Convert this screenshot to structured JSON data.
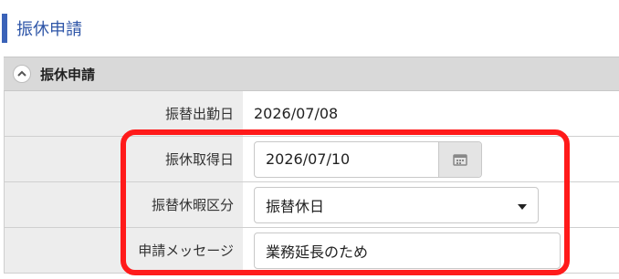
{
  "page": {
    "title": "振休申請"
  },
  "section": {
    "title": "振休申請"
  },
  "form": {
    "work_date": {
      "label": "振替出勤日",
      "value": "2026/07/08"
    },
    "leave_date": {
      "label": "振休取得日",
      "value": "2026/07/10"
    },
    "leave_type": {
      "label": "振替休暇区分",
      "value": "振替休日"
    },
    "message": {
      "label": "申請メッセージ",
      "value": "業務延長のため"
    }
  },
  "icons": {
    "collapse": "chevron-up-icon",
    "calendar": "calendar-icon",
    "dropdown": "caret-down-icon"
  },
  "colors": {
    "accent": "#3a62b8",
    "highlight": "#ff1a1a"
  }
}
